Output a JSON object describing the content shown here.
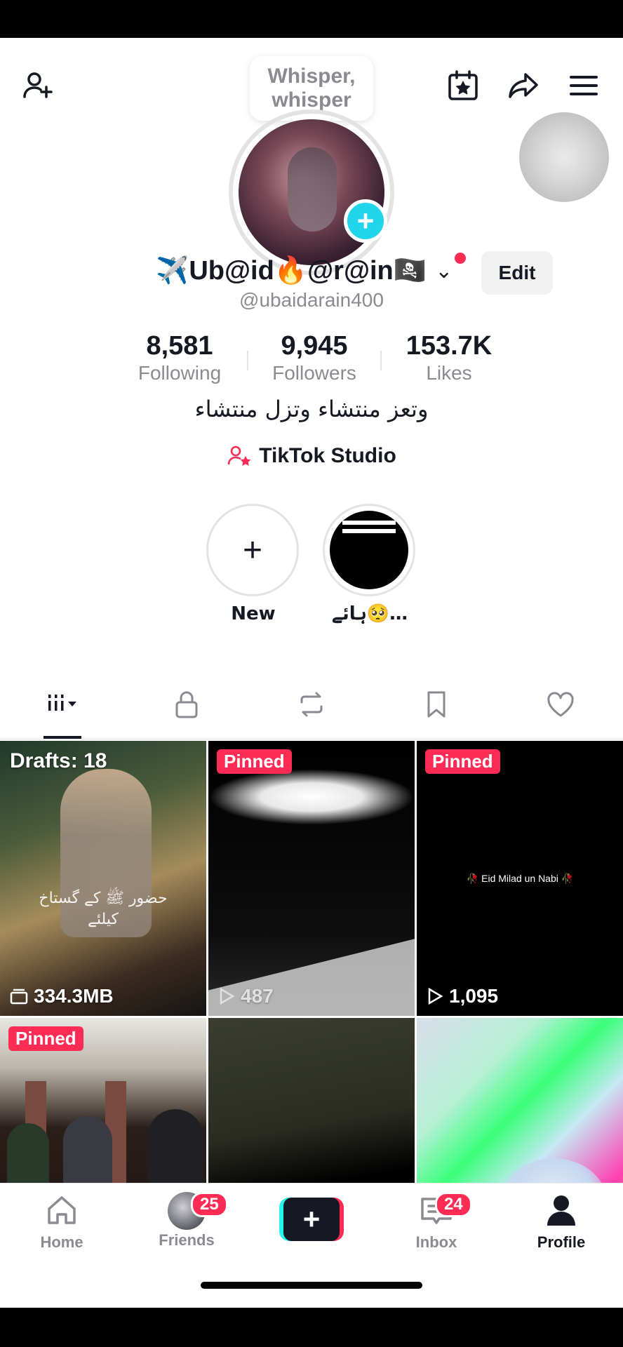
{
  "whisper": {
    "line1": "Whisper,",
    "line2": "whisper"
  },
  "profile": {
    "display_name": "✈️Ub@id🔥@r@in🏴‍☠️",
    "handle": "@ubaidarain400",
    "edit_label": "Edit",
    "bio": "وتعز منتشاء وتزل منتشاء",
    "studio_label": "TikTok Studio"
  },
  "stats": [
    {
      "value": "8,581",
      "label": "Following"
    },
    {
      "value": "9,945",
      "label": "Followers"
    },
    {
      "value": "153.7K",
      "label": "Likes"
    }
  ],
  "highlights": [
    {
      "label": "New"
    },
    {
      "label": "ہائے🥺…"
    }
  ],
  "videos": [
    {
      "overlay": "Drafts: 18",
      "stat": "334.3MB"
    },
    {
      "badge": "Pinned",
      "views": "487"
    },
    {
      "badge": "Pinned",
      "views": "1,095",
      "caption": "🥀 Eid Milad un Nabi 🥀"
    },
    {
      "badge": "Pinned"
    },
    {},
    {}
  ],
  "nav": {
    "home": "Home",
    "friends": "Friends",
    "friends_badge": "25",
    "inbox": "Inbox",
    "inbox_badge": "24",
    "profile": "Profile"
  },
  "colors": {
    "accent": "#fe2c55",
    "cyan": "#25f4ee",
    "text": "#161823",
    "muted": "#8a8b91"
  }
}
